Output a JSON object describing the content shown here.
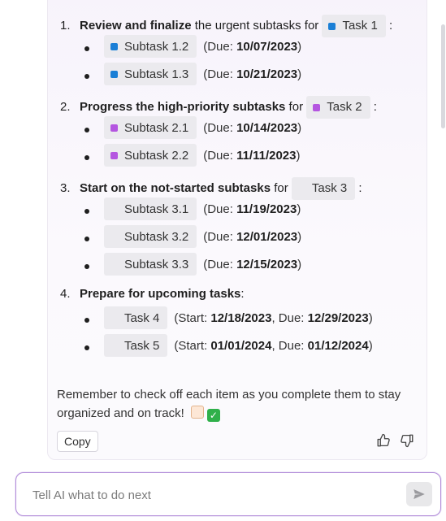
{
  "sections": [
    {
      "num": "1.",
      "bold": "Review and finalize",
      "text": " the urgent subtasks for ",
      "task_label": "Task 1",
      "task_color": "#1a7fd6",
      "after": " :",
      "items": [
        {
          "label": "Subtask 1.2",
          "color": "#1a7fd6",
          "pre": "(Due: ",
          "date": "10/07/2023",
          "post": ")"
        },
        {
          "label": "Subtask 1.3",
          "color": "#1a7fd6",
          "pre": "(Due: ",
          "date": "10/21/2023",
          "post": ")"
        }
      ]
    },
    {
      "num": "2.",
      "bold": "Progress the high-priority subtasks",
      "text": " for ",
      "task_label": "Task 2",
      "task_color": "#b455e0",
      "after": " :",
      "items": [
        {
          "label": "Subtask 2.1",
          "color": "#b455e0",
          "pre": "(Due: ",
          "date": "10/14/2023",
          "post": ")"
        },
        {
          "label": "Subtask 2.2",
          "color": "#b455e0",
          "pre": "(Due: ",
          "date": "11/11/2023",
          "post": ")"
        }
      ]
    },
    {
      "num": "3.",
      "bold": "Start on the not-started subtasks",
      "text": " for ",
      "task_label": "Task 3",
      "task_color": "",
      "after": " :",
      "items": [
        {
          "label": "Subtask 3.1",
          "color": "",
          "pre": "(Due: ",
          "date": "11/19/2023",
          "post": ")"
        },
        {
          "label": "Subtask 3.2",
          "color": "",
          "pre": "(Due: ",
          "date": "12/01/2023",
          "post": ")"
        },
        {
          "label": "Subtask 3.3",
          "color": "",
          "pre": "(Due: ",
          "date": "12/15/2023",
          "post": ")"
        }
      ]
    },
    {
      "num": "4.",
      "bold": "Prepare for upcoming tasks",
      "text": ":",
      "items": [
        {
          "label": "Task 4",
          "color": "",
          "start_pre": "(Start: ",
          "start": "12/18/2023",
          "due_pre": ", Due: ",
          "due": "12/29/2023",
          "post": ")"
        },
        {
          "label": "Task 5",
          "color": "",
          "start_pre": "(Start: ",
          "start": "01/01/2024",
          "due_pre": ", Due: ",
          "due": "01/12/2024",
          "post": ")"
        }
      ]
    }
  ],
  "reminder": "Remember to check off each item as you complete them to stay organized and on track!",
  "reminder_emoji": [
    "memo-icon",
    "check-mark-icon"
  ],
  "copy_label": "Copy",
  "input": {
    "placeholder": "Tell AI what to do next",
    "value": ""
  },
  "icons": {
    "thumbs_up": "thumbs-up-icon",
    "thumbs_down": "thumbs-down-icon",
    "send": "send-icon"
  }
}
